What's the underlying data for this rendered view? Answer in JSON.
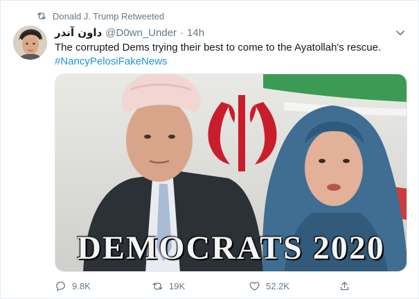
{
  "retweet_context": {
    "label": "Donald J. Trump Retweeted"
  },
  "author": {
    "display_name": "داون آندر",
    "handle": "@D0wn_Under",
    "separator": "·",
    "time": "14h"
  },
  "tweet": {
    "text": "The corrupted Dems trying their best to come to the Ayatollah's rescue.",
    "hashtag": "#NancyPelosiFakeNews"
  },
  "media": {
    "caption": "DEMOCRATS 2020"
  },
  "actions": {
    "replies": "9.8K",
    "retweets": "19K",
    "likes": "52.2K"
  },
  "colors": {
    "link": "#1b95e0",
    "muted": "#657786",
    "text": "#14171a",
    "border": "#e6ecf0"
  }
}
